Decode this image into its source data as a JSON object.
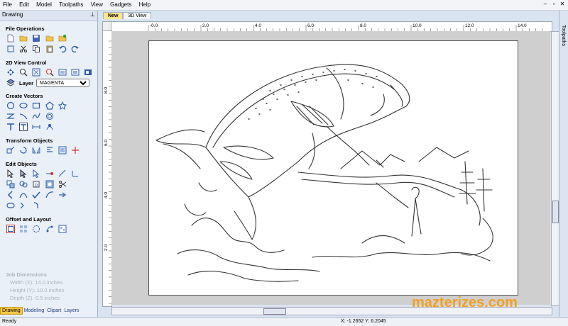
{
  "menu": [
    "File",
    "Edit",
    "Model",
    "Toolpaths",
    "View",
    "Gadgets",
    "Help"
  ],
  "panel": {
    "title": "Drawing",
    "sections": {
      "file_ops": "File Operations",
      "view_ctrl": "2D View Control",
      "create": "Create Vectors",
      "transform": "Transform Objects",
      "edit": "Edit Objects",
      "offset": "Offset and Layout"
    },
    "layer_label": "Layer",
    "layer_value": "MAGENTA"
  },
  "job": {
    "title": "Job Dimensions",
    "width": "Width  (X): 14.0 inches",
    "height": "Height (Y): 10.0 inches",
    "depth": "Depth  (Z): 0.5 inches"
  },
  "bottom_tabs": [
    "Drawing",
    "Modeling",
    "Clipart",
    "Layers"
  ],
  "doc_tabs": [
    "New",
    "3D View"
  ],
  "ruler_top": [
    "-0.0",
    "2.0",
    "4.0",
    "6.0",
    "8.0",
    "10.0",
    "12.0",
    "14.0"
  ],
  "ruler_left": [
    "8.0",
    "6.0",
    "4.0",
    "2.0"
  ],
  "right_tab": "Toolpaths",
  "status": {
    "left": "Ready",
    "coords": "X: -1.2652 Y: 6.2045"
  },
  "watermark": "mazterizes.com",
  "colors": {
    "accent": "#f7c843",
    "panel": "#eaf0f8",
    "watermark": "#f0a020"
  }
}
